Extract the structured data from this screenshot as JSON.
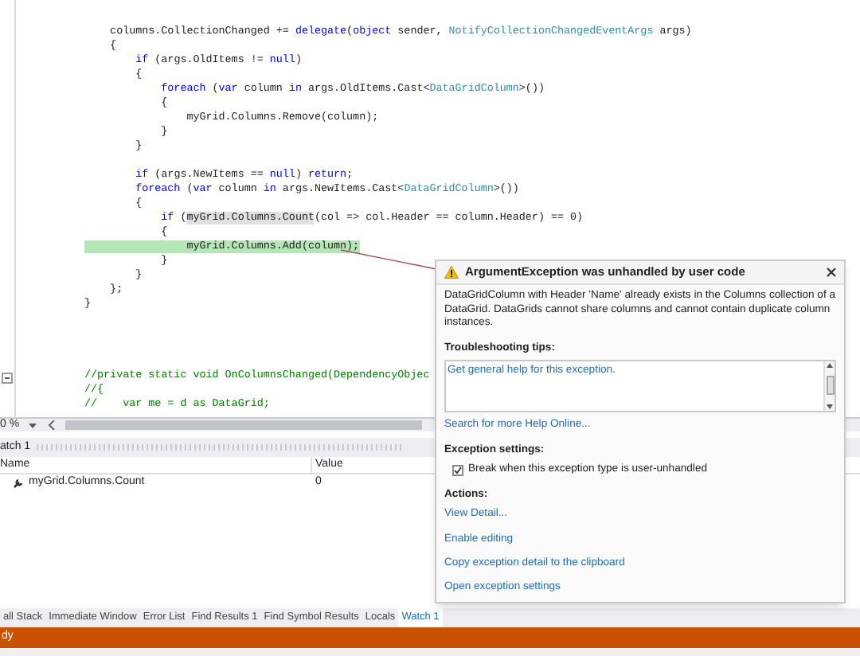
{
  "editor": {
    "blocks": [
      {
        "lines": [
          {
            "segments": [
              {
                "text": "    columns.CollectionChanged += ",
                "kind": "plain"
              },
              {
                "text": "delegate",
                "kind": "keyword"
              },
              {
                "text": "(",
                "kind": "plain"
              },
              {
                "text": "object",
                "kind": "keyword"
              },
              {
                "text": " sender, ",
                "kind": "plain"
              },
              {
                "text": "NotifyCollectionChangedEventArgs",
                "kind": "type"
              },
              {
                "text": " args)",
                "kind": "plain"
              }
            ]
          },
          {
            "segments": [
              {
                "text": "    {",
                "kind": "plain"
              }
            ]
          },
          {
            "segments": [
              {
                "text": "        if",
                "kind": "keyword"
              },
              {
                "text": " (args.OldItems != ",
                "kind": "plain"
              },
              {
                "text": "null",
                "kind": "keyword"
              },
              {
                "text": ")",
                "kind": "plain"
              }
            ]
          },
          {
            "segments": [
              {
                "text": "        {",
                "kind": "plain"
              }
            ]
          },
          {
            "segments": [
              {
                "text": "            foreach",
                "kind": "keyword"
              },
              {
                "text": " (",
                "kind": "plain"
              },
              {
                "text": "var",
                "kind": "keyword"
              },
              {
                "text": " column ",
                "kind": "plain"
              },
              {
                "text": "in",
                "kind": "keyword"
              },
              {
                "text": " args.OldItems.Cast<",
                "kind": "plain"
              },
              {
                "text": "DataGridColumn",
                "kind": "type"
              },
              {
                "text": ">())",
                "kind": "plain"
              }
            ]
          },
          {
            "segments": [
              {
                "text": "            {",
                "kind": "plain"
              }
            ]
          },
          {
            "segments": [
              {
                "text": "                myGrid.Columns.Remove(column);",
                "kind": "plain"
              }
            ]
          },
          {
            "segments": [
              {
                "text": "            }",
                "kind": "plain"
              }
            ]
          },
          {
            "segments": [
              {
                "text": "        }",
                "kind": "plain"
              }
            ]
          }
        ]
      },
      {
        "lines": [
          {
            "segments": [
              {
                "text": "        if",
                "kind": "keyword"
              },
              {
                "text": " (args.NewItems == ",
                "kind": "plain"
              },
              {
                "text": "null",
                "kind": "keyword"
              },
              {
                "text": ") ",
                "kind": "plain"
              },
              {
                "text": "return",
                "kind": "keyword"
              },
              {
                "text": ";",
                "kind": "plain"
              }
            ]
          },
          {
            "segments": [
              {
                "text": "        foreach",
                "kind": "keyword"
              },
              {
                "text": " (",
                "kind": "plain"
              },
              {
                "text": "var",
                "kind": "keyword"
              },
              {
                "text": " column ",
                "kind": "plain"
              },
              {
                "text": "in",
                "kind": "keyword"
              },
              {
                "text": " args.NewItems.Cast<",
                "kind": "plain"
              },
              {
                "text": "DataGridColumn",
                "kind": "type"
              },
              {
                "text": ">())",
                "kind": "plain"
              }
            ]
          },
          {
            "segments": [
              {
                "text": "        {",
                "kind": "plain"
              }
            ]
          },
          {
            "segments": [
              {
                "text": "            if",
                "kind": "keyword"
              },
              {
                "text": " (",
                "kind": "plain"
              },
              {
                "text": "myGrid.Columns.Count",
                "kind": "reference_highlight"
              },
              {
                "text": "(col => col.Header == column.Header) == 0)",
                "kind": "plain"
              }
            ]
          },
          {
            "segments": [
              {
                "text": "            {",
                "kind": "plain"
              }
            ]
          },
          {
            "segments": [
              {
                "text": "                myGrid.Columns.Add(column);",
                "kind": "current_statement"
              }
            ]
          },
          {
            "segments": [
              {
                "text": "            }",
                "kind": "plain"
              }
            ]
          },
          {
            "segments": [
              {
                "text": "        }",
                "kind": "plain"
              }
            ]
          },
          {
            "segments": [
              {
                "text": "    };",
                "kind": "plain"
              }
            ]
          },
          {
            "segments": [
              {
                "text": "}",
                "kind": "plain"
              }
            ]
          }
        ]
      },
      {
        "lines": [
          {
            "segments": [
              {
                "text": "//private static void OnColumnsChanged(DependencyObjec",
                "kind": "comment"
              }
            ]
          },
          {
            "segments": [
              {
                "text": "//{",
                "kind": "comment"
              }
            ]
          },
          {
            "segments": [
              {
                "text": "//    var me = d as DataGrid;",
                "kind": "comment"
              }
            ]
          }
        ]
      }
    ]
  },
  "zoom": {
    "value": "0 %"
  },
  "watch_panel": {
    "title": "atch 1",
    "columns": [
      "Name",
      "Value"
    ],
    "rows": [
      {
        "name": "myGrid.Columns.Count",
        "value": "0"
      }
    ]
  },
  "bottom_tabs": [
    {
      "label": "all Stack",
      "selected": false
    },
    {
      "label": "Immediate Window",
      "selected": false
    },
    {
      "label": "Error List",
      "selected": false
    },
    {
      "label": "Find Results 1",
      "selected": false
    },
    {
      "label": "Find Symbol Results",
      "selected": false
    },
    {
      "label": "Locals",
      "selected": false
    },
    {
      "label": "Watch 1",
      "selected": true
    }
  ],
  "status_bar": {
    "text": "dy"
  },
  "exception_popup": {
    "title": "ArgumentException was unhandled by user code",
    "message": "DataGridColumn with Header 'Name' already exists in the Columns collection of a DataGrid. DataGrids cannot share columns and cannot contain duplicate column instances.",
    "tips_heading": "Troubleshooting tips:",
    "tips": [
      "Get general help for this exception."
    ],
    "help_link": "Search for more Help Online...",
    "settings_heading": "Exception settings:",
    "settings": [
      {
        "label": "Break when this exception type is user-unhandled",
        "checked": true
      }
    ],
    "actions_heading": "Actions:",
    "actions": [
      "View Detail...",
      "Enable editing",
      "Copy exception detail to the clipboard",
      "Open exception settings"
    ]
  }
}
